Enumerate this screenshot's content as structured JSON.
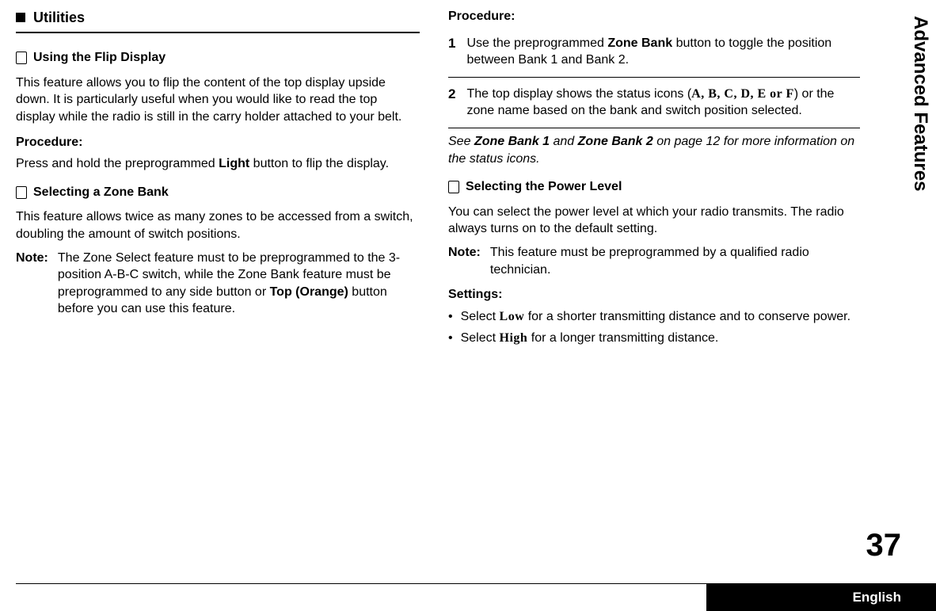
{
  "sideTitle": "Advanced Features",
  "pageNumber": "37",
  "language": "English",
  "left": {
    "sectionTitle": "Utilities",
    "flipDisplay": {
      "title": "Using the Flip Display",
      "body": "This feature allows you to flip the content of the top display upside down. It is particularly useful when you would like to read the top display while the radio is still in the carry holder attached to your belt.",
      "procedureLabel": "Procedure:",
      "procedurePre": "Press and hold the preprogrammed ",
      "procedureBold": "Light",
      "procedurePost": " button to flip the display."
    },
    "zoneBank": {
      "title": "Selecting a Zone Bank",
      "body": "This feature allows twice as many zones to be accessed from a switch, doubling the amount of switch positions.",
      "noteLabel": "Note:",
      "notePre": "The Zone Select feature must to be preprogrammed to the 3-position A-B-C switch, while the Zone Bank feature must be preprogrammed to any side button or ",
      "noteBold": "Top (Orange)",
      "notePost": " button before you can use this feature."
    }
  },
  "right": {
    "procedureLabel": "Procedure:",
    "step1": {
      "num": "1",
      "pre": "Use the preprogrammed ",
      "bold": "Zone Bank",
      "post": " button to toggle the position between Bank 1 and Bank 2."
    },
    "step2": {
      "num": "2",
      "pre": "The top display shows the status icons (",
      "icons": "A, B, C, D, E or F",
      "post": ") or the zone name based on the bank and switch position selected."
    },
    "seeLine": {
      "pre": "See ",
      "b1": "Zone Bank 1",
      "mid": " and ",
      "b2": "Zone Bank 2",
      "post": " on page 12 for more information on the status icons."
    },
    "powerLevel": {
      "title": "Selecting the Power Level",
      "body": "You can select the power level at which your radio transmits. The radio always turns on to the default setting.",
      "noteLabel": "Note:",
      "noteText": "This feature must be preprogrammed by a qualified radio technician.",
      "settingsLabel": "Settings:",
      "low": {
        "pre": "Select ",
        "bold": "Low",
        "post": " for a shorter transmitting distance and to conserve power."
      },
      "high": {
        "pre": "Select ",
        "bold": "High",
        "post": " for a longer transmitting distance."
      }
    }
  }
}
